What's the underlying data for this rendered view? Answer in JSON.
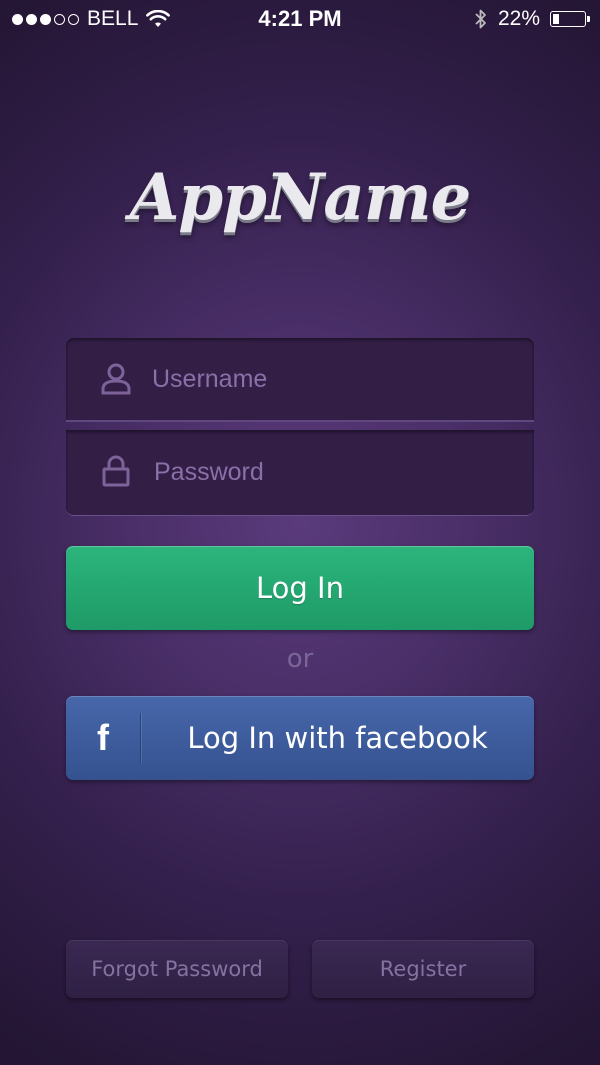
{
  "status_bar": {
    "signal_bars_filled": 3,
    "signal_bars_total": 5,
    "carrier": "BELL",
    "time": "4:21 PM",
    "battery_percent": "22%",
    "battery_level": 0.22
  },
  "logo": {
    "text": "AppName"
  },
  "form": {
    "username_placeholder": "Username",
    "password_placeholder": "Password"
  },
  "buttons": {
    "login": "Log In",
    "or": "or",
    "facebook_icon": "f",
    "facebook": "Log In with facebook",
    "forgot_password": "Forgot Password",
    "register": "Register"
  },
  "colors": {
    "background": "#4a2f68",
    "login_green": "#24a872",
    "facebook_blue": "#3d5c9e",
    "placeholder": "#8a6fa8"
  },
  "icons": {
    "username": "user-icon",
    "password": "lock-icon",
    "facebook": "facebook-icon",
    "wifi": "wifi-icon",
    "bluetooth": "bluetooth-icon",
    "battery": "battery-icon"
  }
}
